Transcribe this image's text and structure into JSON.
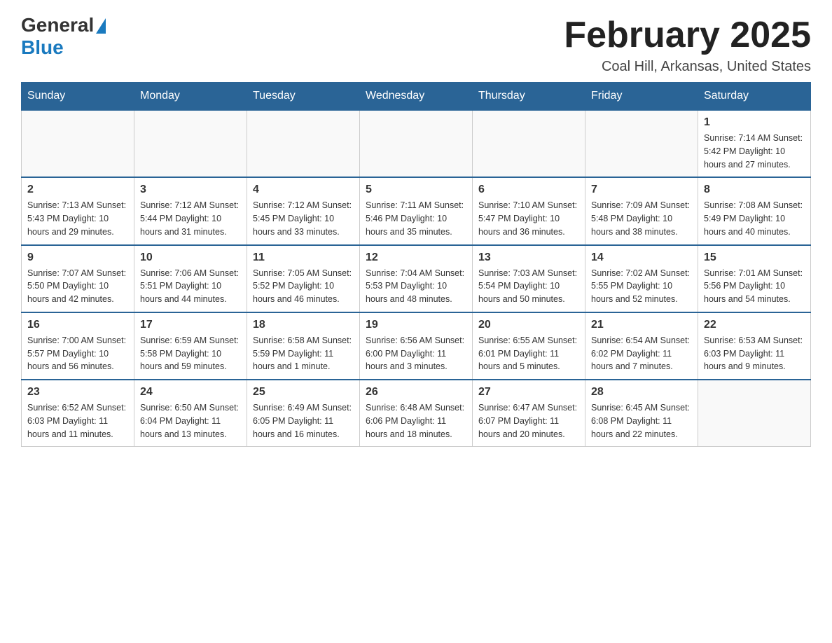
{
  "logo": {
    "general": "General",
    "blue": "Blue"
  },
  "title": "February 2025",
  "subtitle": "Coal Hill, Arkansas, United States",
  "days_of_week": [
    "Sunday",
    "Monday",
    "Tuesday",
    "Wednesday",
    "Thursday",
    "Friday",
    "Saturday"
  ],
  "weeks": [
    [
      {
        "day": "",
        "info": ""
      },
      {
        "day": "",
        "info": ""
      },
      {
        "day": "",
        "info": ""
      },
      {
        "day": "",
        "info": ""
      },
      {
        "day": "",
        "info": ""
      },
      {
        "day": "",
        "info": ""
      },
      {
        "day": "1",
        "info": "Sunrise: 7:14 AM\nSunset: 5:42 PM\nDaylight: 10 hours and 27 minutes."
      }
    ],
    [
      {
        "day": "2",
        "info": "Sunrise: 7:13 AM\nSunset: 5:43 PM\nDaylight: 10 hours and 29 minutes."
      },
      {
        "day": "3",
        "info": "Sunrise: 7:12 AM\nSunset: 5:44 PM\nDaylight: 10 hours and 31 minutes."
      },
      {
        "day": "4",
        "info": "Sunrise: 7:12 AM\nSunset: 5:45 PM\nDaylight: 10 hours and 33 minutes."
      },
      {
        "day": "5",
        "info": "Sunrise: 7:11 AM\nSunset: 5:46 PM\nDaylight: 10 hours and 35 minutes."
      },
      {
        "day": "6",
        "info": "Sunrise: 7:10 AM\nSunset: 5:47 PM\nDaylight: 10 hours and 36 minutes."
      },
      {
        "day": "7",
        "info": "Sunrise: 7:09 AM\nSunset: 5:48 PM\nDaylight: 10 hours and 38 minutes."
      },
      {
        "day": "8",
        "info": "Sunrise: 7:08 AM\nSunset: 5:49 PM\nDaylight: 10 hours and 40 minutes."
      }
    ],
    [
      {
        "day": "9",
        "info": "Sunrise: 7:07 AM\nSunset: 5:50 PM\nDaylight: 10 hours and 42 minutes."
      },
      {
        "day": "10",
        "info": "Sunrise: 7:06 AM\nSunset: 5:51 PM\nDaylight: 10 hours and 44 minutes."
      },
      {
        "day": "11",
        "info": "Sunrise: 7:05 AM\nSunset: 5:52 PM\nDaylight: 10 hours and 46 minutes."
      },
      {
        "day": "12",
        "info": "Sunrise: 7:04 AM\nSunset: 5:53 PM\nDaylight: 10 hours and 48 minutes."
      },
      {
        "day": "13",
        "info": "Sunrise: 7:03 AM\nSunset: 5:54 PM\nDaylight: 10 hours and 50 minutes."
      },
      {
        "day": "14",
        "info": "Sunrise: 7:02 AM\nSunset: 5:55 PM\nDaylight: 10 hours and 52 minutes."
      },
      {
        "day": "15",
        "info": "Sunrise: 7:01 AM\nSunset: 5:56 PM\nDaylight: 10 hours and 54 minutes."
      }
    ],
    [
      {
        "day": "16",
        "info": "Sunrise: 7:00 AM\nSunset: 5:57 PM\nDaylight: 10 hours and 56 minutes."
      },
      {
        "day": "17",
        "info": "Sunrise: 6:59 AM\nSunset: 5:58 PM\nDaylight: 10 hours and 59 minutes."
      },
      {
        "day": "18",
        "info": "Sunrise: 6:58 AM\nSunset: 5:59 PM\nDaylight: 11 hours and 1 minute."
      },
      {
        "day": "19",
        "info": "Sunrise: 6:56 AM\nSunset: 6:00 PM\nDaylight: 11 hours and 3 minutes."
      },
      {
        "day": "20",
        "info": "Sunrise: 6:55 AM\nSunset: 6:01 PM\nDaylight: 11 hours and 5 minutes."
      },
      {
        "day": "21",
        "info": "Sunrise: 6:54 AM\nSunset: 6:02 PM\nDaylight: 11 hours and 7 minutes."
      },
      {
        "day": "22",
        "info": "Sunrise: 6:53 AM\nSunset: 6:03 PM\nDaylight: 11 hours and 9 minutes."
      }
    ],
    [
      {
        "day": "23",
        "info": "Sunrise: 6:52 AM\nSunset: 6:03 PM\nDaylight: 11 hours and 11 minutes."
      },
      {
        "day": "24",
        "info": "Sunrise: 6:50 AM\nSunset: 6:04 PM\nDaylight: 11 hours and 13 minutes."
      },
      {
        "day": "25",
        "info": "Sunrise: 6:49 AM\nSunset: 6:05 PM\nDaylight: 11 hours and 16 minutes."
      },
      {
        "day": "26",
        "info": "Sunrise: 6:48 AM\nSunset: 6:06 PM\nDaylight: 11 hours and 18 minutes."
      },
      {
        "day": "27",
        "info": "Sunrise: 6:47 AM\nSunset: 6:07 PM\nDaylight: 11 hours and 20 minutes."
      },
      {
        "day": "28",
        "info": "Sunrise: 6:45 AM\nSunset: 6:08 PM\nDaylight: 11 hours and 22 minutes."
      },
      {
        "day": "",
        "info": ""
      }
    ]
  ]
}
